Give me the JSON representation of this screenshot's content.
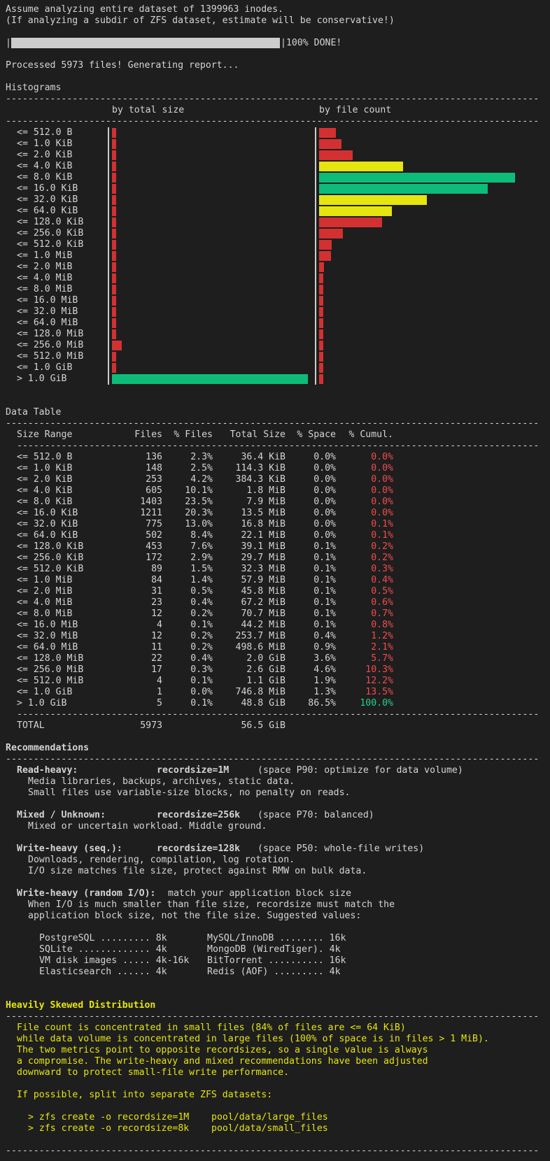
{
  "header": {
    "line1": "Assume analyzing entire dataset of 1399963 inodes.",
    "line2": "(If analyzing a subdir of ZFS dataset, estimate will be conservative!)",
    "progress_pipe_left": "|",
    "progress_pipe_right": "|100% DONE!",
    "progress_fraction": 1.0,
    "processed": "Processed 5973 files! Generating report..."
  },
  "histograms": {
    "title": "Histograms",
    "col_size": "by total size",
    "col_count": "by file count",
    "colors": {
      "red": "#d33131",
      "yellow": "#e5e510",
      "green": "#0dbc79"
    },
    "rows": [
      {
        "label": "<= 512.0 B",
        "size": 0.02,
        "count": 0.085,
        "size_color": "red",
        "count_color": "red"
      },
      {
        "label": "<= 1.0 KiB",
        "size": 0.02,
        "count": 0.115,
        "size_color": "red",
        "count_color": "red"
      },
      {
        "label": "<= 2.0 KiB",
        "size": 0.02,
        "count": 0.17,
        "size_color": "red",
        "count_color": "red"
      },
      {
        "label": "<= 4.0 KiB",
        "size": 0.02,
        "count": 0.43,
        "size_color": "red",
        "count_color": "yellow"
      },
      {
        "label": "<= 8.0 KiB",
        "size": 0.02,
        "count": 1.0,
        "size_color": "red",
        "count_color": "green"
      },
      {
        "label": "<= 16.0 KiB",
        "size": 0.02,
        "count": 0.86,
        "size_color": "red",
        "count_color": "green"
      },
      {
        "label": "<= 32.0 KiB",
        "size": 0.02,
        "count": 0.55,
        "size_color": "red",
        "count_color": "yellow"
      },
      {
        "label": "<= 64.0 KiB",
        "size": 0.02,
        "count": 0.37,
        "size_color": "red",
        "count_color": "yellow"
      },
      {
        "label": "<= 128.0 KiB",
        "size": 0.02,
        "count": 0.32,
        "size_color": "red",
        "count_color": "red"
      },
      {
        "label": "<= 256.0 KiB",
        "size": 0.02,
        "count": 0.12,
        "size_color": "red",
        "count_color": "red"
      },
      {
        "label": "<= 512.0 KiB",
        "size": 0.02,
        "count": 0.065,
        "size_color": "red",
        "count_color": "red"
      },
      {
        "label": "<= 1.0 MiB",
        "size": 0.02,
        "count": 0.06,
        "size_color": "red",
        "count_color": "red"
      },
      {
        "label": "<= 2.0 MiB",
        "size": 0.02,
        "count": 0.025,
        "size_color": "red",
        "count_color": "red"
      },
      {
        "label": "<= 4.0 MiB",
        "size": 0.02,
        "count": 0.02,
        "size_color": "red",
        "count_color": "red"
      },
      {
        "label": "<= 8.0 MiB",
        "size": 0.02,
        "count": 0.02,
        "size_color": "red",
        "count_color": "red"
      },
      {
        "label": "<= 16.0 MiB",
        "size": 0.02,
        "count": 0.02,
        "size_color": "red",
        "count_color": "red"
      },
      {
        "label": "<= 32.0 MiB",
        "size": 0.02,
        "count": 0.02,
        "size_color": "red",
        "count_color": "red"
      },
      {
        "label": "<= 64.0 MiB",
        "size": 0.02,
        "count": 0.02,
        "size_color": "red",
        "count_color": "red"
      },
      {
        "label": "<= 128.0 MiB",
        "size": 0.02,
        "count": 0.02,
        "size_color": "red",
        "count_color": "red"
      },
      {
        "label": "<= 256.0 MiB",
        "size": 0.05,
        "count": 0.02,
        "size_color": "red",
        "count_color": "red"
      },
      {
        "label": "<= 512.0 MiB",
        "size": 0.02,
        "count": 0.02,
        "size_color": "red",
        "count_color": "red"
      },
      {
        "label": "<= 1.0 GiB",
        "size": 0.02,
        "count": 0.02,
        "size_color": "red",
        "count_color": "red"
      },
      {
        "label": "> 1.0 GiB",
        "size": 1.0,
        "count": 0.02,
        "size_color": "green",
        "count_color": "red"
      }
    ]
  },
  "table": {
    "title": "Data Table",
    "headers": {
      "range": "Size Range",
      "files": "Files",
      "pct_files": "% Files",
      "total": "Total Size",
      "pct_space": "% Space",
      "cumul": "% Cumul."
    },
    "rows": [
      {
        "range": "<= 512.0 B",
        "files": "136",
        "pct_files": "2.3%",
        "total": "36.4 KiB",
        "pct_space": "0.0%",
        "cumul": "0.0%",
        "cumul_color": "red"
      },
      {
        "range": "<= 1.0 KiB",
        "files": "148",
        "pct_files": "2.5%",
        "total": "114.3 KiB",
        "pct_space": "0.0%",
        "cumul": "0.0%",
        "cumul_color": "red"
      },
      {
        "range": "<= 2.0 KiB",
        "files": "253",
        "pct_files": "4.2%",
        "total": "384.3 KiB",
        "pct_space": "0.0%",
        "cumul": "0.0%",
        "cumul_color": "red"
      },
      {
        "range": "<= 4.0 KiB",
        "files": "605",
        "pct_files": "10.1%",
        "total": "1.8 MiB",
        "pct_space": "0.0%",
        "cumul": "0.0%",
        "cumul_color": "red"
      },
      {
        "range": "<= 8.0 KiB",
        "files": "1403",
        "pct_files": "23.5%",
        "total": "7.9 MiB",
        "pct_space": "0.0%",
        "cumul": "0.0%",
        "cumul_color": "red"
      },
      {
        "range": "<= 16.0 KiB",
        "files": "1211",
        "pct_files": "20.3%",
        "total": "13.5 MiB",
        "pct_space": "0.0%",
        "cumul": "0.0%",
        "cumul_color": "red"
      },
      {
        "range": "<= 32.0 KiB",
        "files": "775",
        "pct_files": "13.0%",
        "total": "16.8 MiB",
        "pct_space": "0.0%",
        "cumul": "0.1%",
        "cumul_color": "red"
      },
      {
        "range": "<= 64.0 KiB",
        "files": "502",
        "pct_files": "8.4%",
        "total": "22.1 MiB",
        "pct_space": "0.0%",
        "cumul": "0.1%",
        "cumul_color": "red"
      },
      {
        "range": "<= 128.0 KiB",
        "files": "453",
        "pct_files": "7.6%",
        "total": "39.1 MiB",
        "pct_space": "0.1%",
        "cumul": "0.2%",
        "cumul_color": "red"
      },
      {
        "range": "<= 256.0 KiB",
        "files": "172",
        "pct_files": "2.9%",
        "total": "29.7 MiB",
        "pct_space": "0.1%",
        "cumul": "0.2%",
        "cumul_color": "red"
      },
      {
        "range": "<= 512.0 KiB",
        "files": "89",
        "pct_files": "1.5%",
        "total": "32.3 MiB",
        "pct_space": "0.1%",
        "cumul": "0.3%",
        "cumul_color": "red"
      },
      {
        "range": "<= 1.0 MiB",
        "files": "84",
        "pct_files": "1.4%",
        "total": "57.9 MiB",
        "pct_space": "0.1%",
        "cumul": "0.4%",
        "cumul_color": "red"
      },
      {
        "range": "<= 2.0 MiB",
        "files": "31",
        "pct_files": "0.5%",
        "total": "45.8 MiB",
        "pct_space": "0.1%",
        "cumul": "0.5%",
        "cumul_color": "red"
      },
      {
        "range": "<= 4.0 MiB",
        "files": "23",
        "pct_files": "0.4%",
        "total": "67.2 MiB",
        "pct_space": "0.1%",
        "cumul": "0.6%",
        "cumul_color": "red"
      },
      {
        "range": "<= 8.0 MiB",
        "files": "12",
        "pct_files": "0.2%",
        "total": "70.7 MiB",
        "pct_space": "0.1%",
        "cumul": "0.7%",
        "cumul_color": "red"
      },
      {
        "range": "<= 16.0 MiB",
        "files": "4",
        "pct_files": "0.1%",
        "total": "44.2 MiB",
        "pct_space": "0.1%",
        "cumul": "0.8%",
        "cumul_color": "red"
      },
      {
        "range": "<= 32.0 MiB",
        "files": "12",
        "pct_files": "0.2%",
        "total": "253.7 MiB",
        "pct_space": "0.4%",
        "cumul": "1.2%",
        "cumul_color": "red"
      },
      {
        "range": "<= 64.0 MiB",
        "files": "11",
        "pct_files": "0.2%",
        "total": "498.6 MiB",
        "pct_space": "0.9%",
        "cumul": "2.1%",
        "cumul_color": "red"
      },
      {
        "range": "<= 128.0 MiB",
        "files": "22",
        "pct_files": "0.4%",
        "total": "2.0 GiB",
        "pct_space": "3.6%",
        "cumul": "5.7%",
        "cumul_color": "red"
      },
      {
        "range": "<= 256.0 MiB",
        "files": "17",
        "pct_files": "0.3%",
        "total": "2.6 GiB",
        "pct_space": "4.6%",
        "cumul": "10.3%",
        "cumul_color": "red"
      },
      {
        "range": "<= 512.0 MiB",
        "files": "4",
        "pct_files": "0.1%",
        "total": "1.1 GiB",
        "pct_space": "1.9%",
        "cumul": "12.2%",
        "cumul_color": "red"
      },
      {
        "range": "<= 1.0 GiB",
        "files": "1",
        "pct_files": "0.0%",
        "total": "746.8 MiB",
        "pct_space": "1.3%",
        "cumul": "13.5%",
        "cumul_color": "red"
      },
      {
        "range": "> 1.0 GiB",
        "files": "5",
        "pct_files": "0.1%",
        "total": "48.8 GiB",
        "pct_space": "86.5%",
        "cumul": "100.0%",
        "cumul_color": "green"
      }
    ],
    "total": {
      "label": "TOTAL",
      "files": "5973",
      "size": "56.5 GiB"
    }
  },
  "recommendations": {
    "title": "Recommendations",
    "read_heavy": {
      "label": "Read-heavy:",
      "value": "recordsize=1M",
      "note": "(space P90: optimize for data volume)",
      "lines": [
        "Media libraries, backups, archives, static data.",
        "Small files use variable-size blocks, no penalty on reads."
      ]
    },
    "mixed": {
      "label": "Mixed / Unknown:",
      "value": "recordsize=256k",
      "note": "(space P70: balanced)",
      "lines": [
        "Mixed or uncertain workload. Middle ground."
      ]
    },
    "write_seq": {
      "label": "Write-heavy (seq.):",
      "value": "recordsize=128k",
      "note": "(space P50: whole-file writes)",
      "lines": [
        "Downloads, rendering, compilation, log rotation.",
        "I/O size matches file size, protect against RMW on bulk data."
      ]
    },
    "write_random": {
      "label": "Write-heavy (random I/O):",
      "value": "match your application block size",
      "lines": [
        "When I/O is much smaller than file size, recordsize must match the",
        "application block size, not the file size. Suggested values:"
      ]
    },
    "apps": [
      [
        "PostgreSQL ......... 8k",
        "MySQL/InnoDB ........ 16k"
      ],
      [
        "SQLite ............. 4k",
        "MongoDB (WiredTiger). 4k"
      ],
      [
        "VM disk images ..... 4k-16k",
        "BitTorrent .......... 16k"
      ],
      [
        "Elasticsearch ...... 4k",
        "Redis (AOF) ......... 4k"
      ]
    ]
  },
  "warning": {
    "title": "Heavily Skewed Distribution",
    "lines": [
      "File count is concentrated in small files (84% of files are <= 64 KiB)",
      "while data volume is concentrated in large files (100% of space is in files > 1 MiB).",
      "The two metrics point to opposite recordsizes, so a single value is always",
      "a compromise. The write-heavy and mixed recommendations have been adjusted",
      "downward to protect small-file write performance."
    ],
    "split_prompt": "If possible, split into separate ZFS datasets:",
    "commands": [
      "> zfs create -o recordsize=1M    pool/data/large_files",
      "> zfs create -o recordsize=8k    pool/data/small_files"
    ]
  },
  "rule_char": "-"
}
